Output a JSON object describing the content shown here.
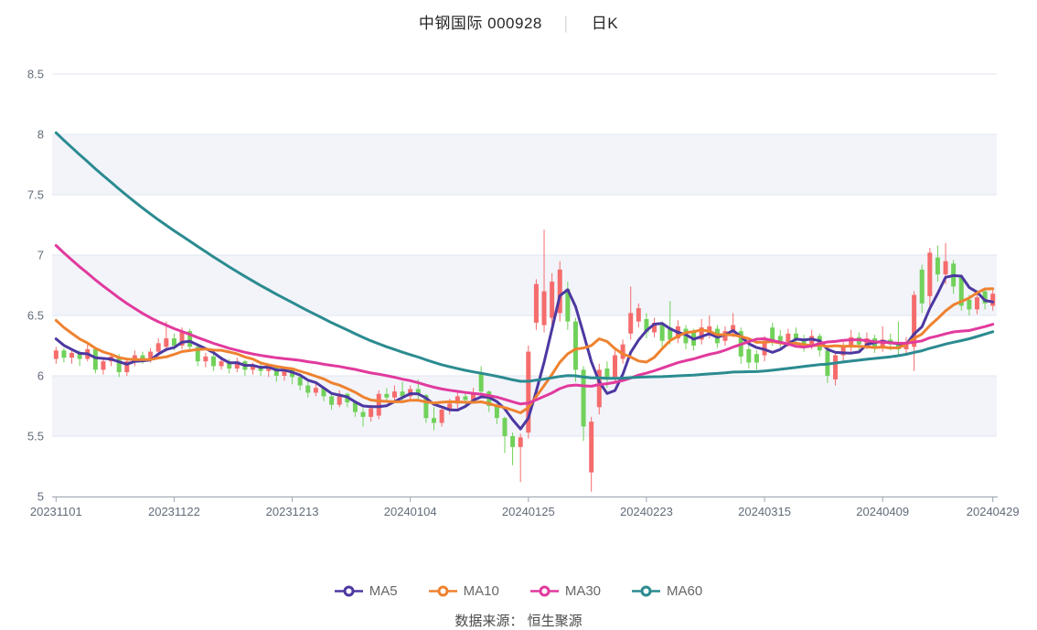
{
  "title": {
    "stock_name_and_code": "中钢国际 000928",
    "separator": "│",
    "period_label": "日K"
  },
  "footer": {
    "data_source": "数据来源： 恒生聚源"
  },
  "axes": {
    "y_ticks": [
      {
        "label": "8.5",
        "value": 8.5
      },
      {
        "label": "8",
        "value": 8.0
      },
      {
        "label": "7.5",
        "value": 7.5
      },
      {
        "label": "7",
        "value": 7.0
      },
      {
        "label": "6.5",
        "value": 6.5
      },
      {
        "label": "6",
        "value": 6.0
      },
      {
        "label": "5.5",
        "value": 5.5
      },
      {
        "label": "5",
        "value": 5.0
      }
    ],
    "x_ticks": {
      "labels": [
        "20231101",
        "20231122",
        "20231213",
        "20240104",
        "20240125",
        "20240223",
        "20240315",
        "20240409",
        "20240429"
      ],
      "indices": [
        0,
        15,
        30,
        45,
        60,
        75,
        90,
        105,
        119
      ]
    }
  },
  "style_colors": {
    "up": "#f56c6c",
    "down": "#71d15a",
    "grid": "#e0e6f0",
    "band_tint": "#f2f4fa",
    "axis_line": "#9aa3b0",
    "axis_label": "#626c7a",
    "background": "#ffffff"
  },
  "chart_data": {
    "type": "candlestick",
    "title": "中钢国际 000928 日K",
    "price_axis": {
      "min": 5,
      "max": 8.5,
      "interval": 0.5
    },
    "grid": "horizontal-only",
    "legend_position": "bottom",
    "columns": [
      "date",
      "open",
      "close",
      "low",
      "high"
    ],
    "candles": [
      [
        "20231101",
        6.14,
        6.21,
        6.1,
        6.24
      ],
      [
        "20231102",
        6.21,
        6.15,
        6.11,
        6.23
      ],
      [
        "20231103",
        6.15,
        6.19,
        6.1,
        6.22
      ],
      [
        "20231106",
        6.19,
        6.14,
        6.08,
        6.21
      ],
      [
        "20231107",
        6.14,
        6.22,
        6.12,
        6.26
      ],
      [
        "20231108",
        6.22,
        6.05,
        6.02,
        6.24
      ],
      [
        "20231109",
        6.05,
        6.12,
        6.01,
        6.15
      ],
      [
        "20231110",
        6.12,
        6.16,
        6.08,
        6.19
      ],
      [
        "20231113",
        6.16,
        6.03,
        5.99,
        6.18
      ],
      [
        "20231114",
        6.03,
        6.12,
        6.0,
        6.15
      ],
      [
        "20231115",
        6.12,
        6.17,
        6.08,
        6.21
      ],
      [
        "20231116",
        6.17,
        6.14,
        6.1,
        6.2
      ],
      [
        "20231117",
        6.14,
        6.2,
        6.11,
        6.23
      ],
      [
        "20231120",
        6.2,
        6.27,
        6.16,
        6.31
      ],
      [
        "20231121",
        6.24,
        6.31,
        6.2,
        6.45
      ],
      [
        "20231122",
        6.31,
        6.25,
        6.21,
        6.35
      ],
      [
        "20231123",
        6.25,
        6.36,
        6.22,
        6.4
      ],
      [
        "20231124",
        6.37,
        6.24,
        6.2,
        6.39
      ],
      [
        "20231127",
        6.24,
        6.12,
        6.08,
        6.25
      ],
      [
        "20231128",
        6.12,
        6.16,
        6.07,
        6.19
      ],
      [
        "20231129",
        6.16,
        6.08,
        6.04,
        6.18
      ],
      [
        "20231130",
        6.08,
        6.12,
        6.05,
        6.16
      ],
      [
        "20231201",
        6.12,
        6.06,
        6.02,
        6.14
      ],
      [
        "20231204",
        6.06,
        6.12,
        6.03,
        6.15
      ],
      [
        "20231205",
        6.12,
        6.05,
        6.0,
        6.13
      ],
      [
        "20231206",
        6.05,
        6.08,
        6.01,
        6.11
      ],
      [
        "20231207",
        6.08,
        6.04,
        6.0,
        6.1
      ],
      [
        "20231208",
        6.04,
        6.07,
        5.99,
        6.1
      ],
      [
        "20231211",
        6.07,
        6.0,
        5.95,
        6.08
      ],
      [
        "20231212",
        6.0,
        6.05,
        5.96,
        6.08
      ],
      [
        "20231213",
        6.05,
        5.99,
        5.93,
        6.06
      ],
      [
        "20231214",
        5.99,
        5.92,
        5.88,
        6.01
      ],
      [
        "20231215",
        5.92,
        5.86,
        5.82,
        5.95
      ],
      [
        "20231218",
        5.86,
        5.9,
        5.83,
        5.93
      ],
      [
        "20231219",
        5.9,
        5.83,
        5.79,
        5.91
      ],
      [
        "20231220",
        5.83,
        5.76,
        5.72,
        5.85
      ],
      [
        "20231221",
        5.76,
        5.85,
        5.74,
        5.88
      ],
      [
        "20231222",
        5.85,
        5.78,
        5.74,
        5.86
      ],
      [
        "20231225",
        5.78,
        5.7,
        5.66,
        5.8
      ],
      [
        "20231226",
        5.7,
        5.66,
        5.58,
        5.73
      ],
      [
        "20231227",
        5.66,
        5.73,
        5.62,
        5.76
      ],
      [
        "20231228",
        5.67,
        5.85,
        5.64,
        5.88
      ],
      [
        "20231229",
        5.85,
        5.82,
        5.78,
        5.9
      ],
      [
        "20240102",
        5.82,
        5.87,
        5.79,
        5.92
      ],
      [
        "20240103",
        5.87,
        5.83,
        5.79,
        5.95
      ],
      [
        "20240104",
        5.83,
        5.89,
        5.8,
        5.92
      ],
      [
        "20240105",
        5.89,
        5.84,
        5.8,
        5.97
      ],
      [
        "20240108",
        5.84,
        5.65,
        5.61,
        5.85
      ],
      [
        "20240109",
        5.65,
        5.61,
        5.55,
        5.74
      ],
      [
        "20240110",
        5.61,
        5.72,
        5.58,
        5.75
      ],
      [
        "20240111",
        5.72,
        5.77,
        5.68,
        5.81
      ],
      [
        "20240112",
        5.77,
        5.83,
        5.73,
        5.86
      ],
      [
        "20240115",
        5.83,
        5.8,
        5.76,
        5.87
      ],
      [
        "20240116",
        5.8,
        5.86,
        5.77,
        5.9
      ],
      [
        "20240117",
        6.02,
        5.87,
        5.84,
        6.08
      ],
      [
        "20240118",
        5.87,
        5.75,
        5.7,
        5.88
      ],
      [
        "20240119",
        5.75,
        5.65,
        5.6,
        5.77
      ],
      [
        "20240122",
        5.65,
        5.5,
        5.36,
        5.66
      ],
      [
        "20240123",
        5.5,
        5.41,
        5.26,
        5.53
      ],
      [
        "20240124",
        5.41,
        5.49,
        5.12,
        5.52
      ],
      [
        "20240125",
        5.53,
        6.2,
        5.48,
        6.25
      ],
      [
        "20240126",
        6.44,
        6.76,
        6.38,
        6.8
      ],
      [
        "20240129",
        6.42,
        6.7,
        6.36,
        7.21
      ],
      [
        "20240130",
        6.48,
        6.78,
        6.42,
        6.85
      ],
      [
        "20240131",
        6.52,
        6.88,
        6.45,
        6.95
      ],
      [
        "20240201",
        6.72,
        6.45,
        6.38,
        6.78
      ],
      [
        "20240202",
        6.45,
        6.05,
        5.95,
        6.48
      ],
      [
        "20240205",
        6.05,
        5.58,
        5.46,
        6.08
      ],
      [
        "20240206",
        5.2,
        5.62,
        5.04,
        5.66
      ],
      [
        "20240207",
        5.74,
        6.05,
        5.68,
        6.1
      ],
      [
        "20240208",
        6.06,
        5.97,
        5.9,
        6.12
      ],
      [
        "20240219",
        5.99,
        6.17,
        5.95,
        6.21
      ],
      [
        "20240220",
        6.14,
        6.26,
        6.1,
        6.3
      ],
      [
        "20240221",
        6.35,
        6.52,
        6.3,
        6.74
      ],
      [
        "20240222",
        6.45,
        6.56,
        6.4,
        6.6
      ],
      [
        "20240223",
        6.47,
        6.36,
        6.31,
        6.52
      ],
      [
        "20240226",
        6.36,
        6.44,
        6.32,
        6.48
      ],
      [
        "20240227",
        6.42,
        6.29,
        6.24,
        6.45
      ],
      [
        "20240228",
        6.4,
        6.3,
        6.26,
        6.62
      ],
      [
        "20240229",
        6.31,
        6.41,
        6.27,
        6.46
      ],
      [
        "20240301",
        6.39,
        6.27,
        6.22,
        6.42
      ],
      [
        "20240304",
        6.36,
        6.25,
        6.21,
        6.39
      ],
      [
        "20240305",
        6.3,
        6.4,
        6.26,
        6.47
      ],
      [
        "20240306",
        6.35,
        6.41,
        6.31,
        6.5
      ],
      [
        "20240307",
        6.39,
        6.27,
        6.23,
        6.42
      ],
      [
        "20240308",
        6.29,
        6.37,
        6.25,
        6.41
      ],
      [
        "20240311",
        6.36,
        6.42,
        6.32,
        6.52
      ],
      [
        "20240312",
        6.37,
        6.16,
        6.1,
        6.4
      ],
      [
        "20240313",
        6.22,
        6.11,
        6.06,
        6.25
      ],
      [
        "20240314",
        6.18,
        6.11,
        6.05,
        6.21
      ],
      [
        "20240315",
        6.17,
        6.29,
        6.12,
        6.33
      ],
      [
        "20240318",
        6.4,
        6.3,
        6.25,
        6.44
      ],
      [
        "20240319",
        6.33,
        6.28,
        6.23,
        6.38
      ],
      [
        "20240320",
        6.28,
        6.35,
        6.24,
        6.39
      ],
      [
        "20240321",
        6.35,
        6.3,
        6.26,
        6.4
      ],
      [
        "20240322",
        6.3,
        6.26,
        6.2,
        6.34
      ],
      [
        "20240325",
        6.26,
        6.33,
        6.22,
        6.38
      ],
      [
        "20240326",
        6.33,
        6.21,
        6.16,
        6.35
      ],
      [
        "20240327",
        6.21,
        6.0,
        5.94,
        6.23
      ],
      [
        "20240328",
        5.97,
        6.17,
        5.92,
        6.2
      ],
      [
        "20240329",
        6.17,
        6.24,
        6.12,
        6.28
      ],
      [
        "20240401",
        6.24,
        6.32,
        6.2,
        6.38
      ],
      [
        "20240402",
        6.32,
        6.26,
        6.21,
        6.36
      ],
      [
        "20240403",
        6.26,
        6.31,
        6.22,
        6.36
      ],
      [
        "20240408",
        6.31,
        6.24,
        6.19,
        6.34
      ],
      [
        "20240409",
        6.24,
        6.3,
        6.2,
        6.41
      ],
      [
        "20240410",
        6.3,
        6.26,
        6.21,
        6.35
      ],
      [
        "20240411",
        6.26,
        6.22,
        6.17,
        6.45
      ],
      [
        "20240412",
        6.22,
        6.28,
        6.18,
        6.32
      ],
      [
        "20240415",
        6.24,
        6.67,
        6.04,
        6.7
      ],
      [
        "20240416",
        6.88,
        6.6,
        6.52,
        6.92
      ],
      [
        "20240417",
        6.66,
        7.02,
        6.58,
        7.06
      ],
      [
        "20240418",
        6.98,
        6.84,
        6.78,
        7.08
      ],
      [
        "20240419",
        6.84,
        6.95,
        6.76,
        7.1
      ],
      [
        "20240422",
        6.93,
        6.74,
        6.68,
        6.96
      ],
      [
        "20240423",
        6.82,
        6.58,
        6.54,
        6.84
      ],
      [
        "20240424",
        6.63,
        6.55,
        6.5,
        6.67
      ],
      [
        "20240425",
        6.55,
        6.65,
        6.51,
        6.68
      ],
      [
        "20240426",
        6.7,
        6.6,
        6.55,
        6.73
      ],
      [
        "20240429",
        6.58,
        6.68,
        6.54,
        6.71
      ]
    ],
    "overlays": [
      {
        "name": "MA5",
        "period": 5,
        "color": "#4d38a1"
      },
      {
        "name": "MA10",
        "period": 10,
        "color": "#ee8230"
      },
      {
        "name": "MA30",
        "period": 30,
        "color": "#e13a9d"
      },
      {
        "name": "MA60",
        "period": 60,
        "color": "#2b8b90"
      }
    ],
    "prehistory_closes_for_ma": [
      9.85,
      9.79,
      9.73,
      9.66,
      9.6,
      9.54,
      9.48,
      9.41,
      9.35,
      9.29,
      9.23,
      9.17,
      9.1,
      9.04,
      8.98,
      8.92,
      8.85,
      8.79,
      8.73,
      8.67,
      8.6,
      8.54,
      8.48,
      8.42,
      8.36,
      8.29,
      8.23,
      8.17,
      8.11,
      8.04,
      7.98,
      7.92,
      7.86,
      7.79,
      7.73,
      7.67,
      7.61,
      7.55,
      7.48,
      7.42,
      7.36,
      7.3,
      7.23,
      7.17,
      7.11,
      7.05,
      6.98,
      6.92,
      6.86,
      6.8,
      6.74,
      6.67,
      6.61,
      6.55,
      6.49,
      6.42,
      6.36,
      6.3,
      6.24
    ]
  }
}
